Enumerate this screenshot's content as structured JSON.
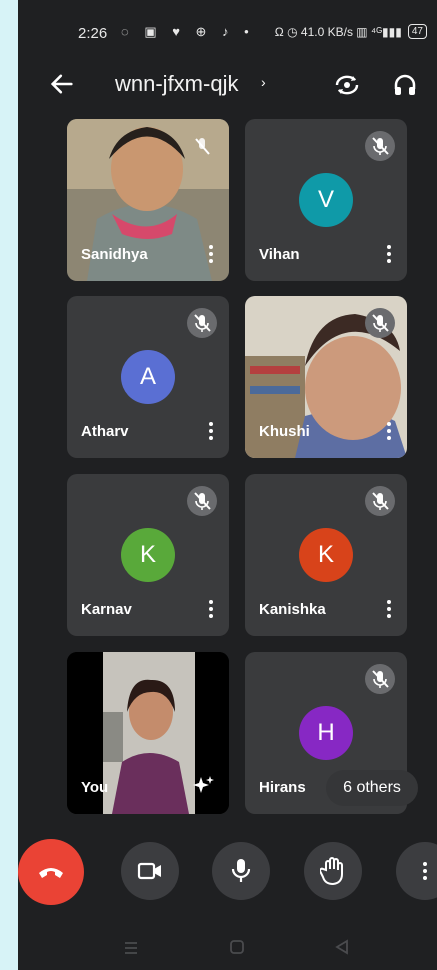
{
  "status": {
    "time": "2:26",
    "left_icons": "◌ ▣ ♥ ⊕ ♪ •",
    "right_text": "Ω ◷ 41.0 KB/s ▥ ⁴ᴳ▮▮▮",
    "battery": "47"
  },
  "meeting": {
    "code": "wnn-jfxm-qjk",
    "caret": "›"
  },
  "participants": [
    {
      "name": "Sanidhya"
    },
    {
      "name": "Vihan",
      "initial": "V",
      "color": "#0f9aa8"
    },
    {
      "name": "Atharv",
      "initial": "A",
      "color": "#5a6fd3"
    },
    {
      "name": "Khushi"
    },
    {
      "name": "Karnav",
      "initial": "K",
      "color": "#59a93a"
    },
    {
      "name": "Kanishka",
      "initial": "K",
      "color": "#d8431a"
    },
    {
      "name": "You"
    },
    {
      "name": "Hirans",
      "initial": "H",
      "color": "#8728c4"
    }
  ],
  "others_label": "6 others"
}
